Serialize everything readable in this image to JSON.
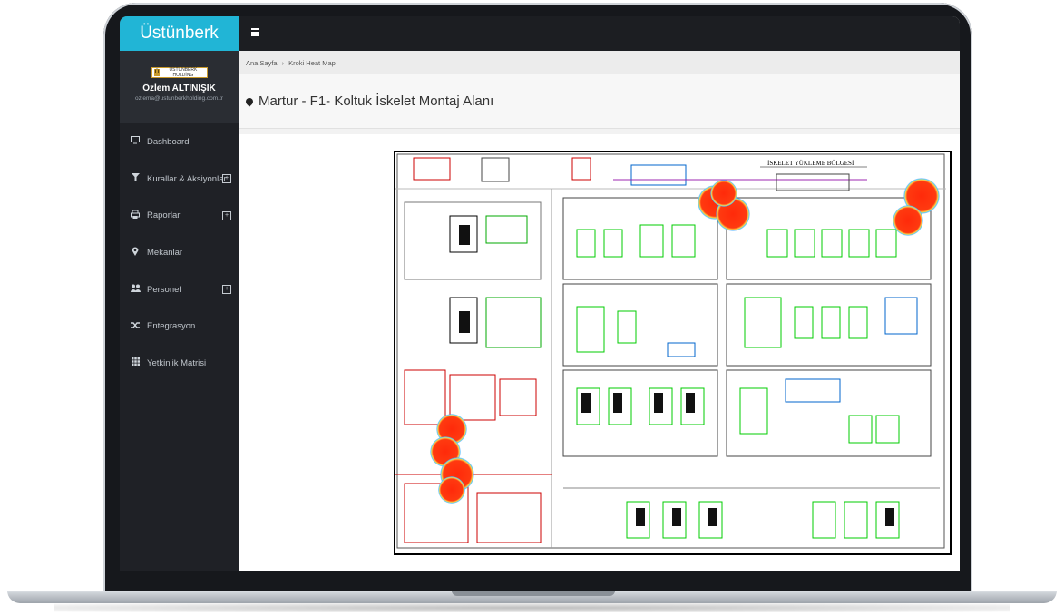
{
  "brand": {
    "name": "Üstünberk",
    "logo_text": "ÜSTÜNBERK HOLDİNG"
  },
  "user": {
    "name": "Özlem ALTINIŞIK",
    "email": "ozlema@ustunberkholding.com.tr"
  },
  "nav": [
    {
      "label": "Dashboard",
      "icon": "monitor-icon",
      "expandable": false
    },
    {
      "label": "Kurallar & Aksiyonlar",
      "icon": "filter-icon",
      "expandable": true
    },
    {
      "label": "Raporlar",
      "icon": "print-icon",
      "expandable": true
    },
    {
      "label": "Mekanlar",
      "icon": "map-marker-icon",
      "expandable": false
    },
    {
      "label": "Personel",
      "icon": "users-icon",
      "expandable": true
    },
    {
      "label": "Entegrasyon",
      "icon": "shuffle-icon",
      "expandable": false
    },
    {
      "label": "Yetkinlik Matrisi",
      "icon": "grid-icon",
      "expandable": false
    }
  ],
  "breadcrumb": {
    "home": "Ana Sayfa",
    "current": "Kroki Heat Map"
  },
  "page": {
    "title": "Martur - F1- Koltuk İskelet Montaj Alanı"
  },
  "map": {
    "zone_label": "İSKELET YÜKLEME BÖLGESİ",
    "heat_color": "#ff2a0a"
  }
}
